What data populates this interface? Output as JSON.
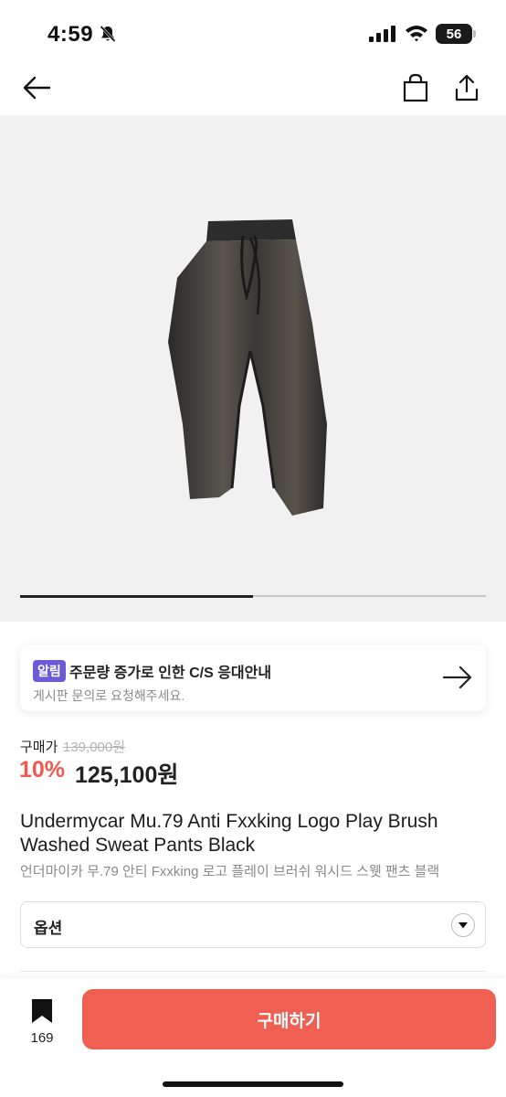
{
  "status_bar": {
    "time": "4:59",
    "battery": "56",
    "icons": [
      "bell-muted-icon",
      "signal-icon",
      "wifi-icon",
      "battery-icon"
    ]
  },
  "nav": {
    "icons": [
      "back-arrow-icon",
      "shopping-bag-icon",
      "share-icon"
    ]
  },
  "gallery": {
    "progress": 0.5
  },
  "notice": {
    "tag": "알림",
    "title": "주문량 증가로 인한 C/S 응대안내",
    "subtitle": "게시판 문의로 요청해주세요.",
    "tag_color": "#6b5bd6"
  },
  "price": {
    "label": "구매가",
    "original": "139,000원",
    "discount": "10%",
    "current": "125,100원",
    "accent_color": "#ef5a4f"
  },
  "product": {
    "title": "Undermycar Mu.79 Anti Fxxking Logo Play Brush Washed Sweat Pants Black",
    "subtitle": "언더마이카 무.79 안티 Fxxking 로고 플레이 브러쉬 워시드 스웻 팬츠 블랙"
  },
  "option": {
    "label": "옵션"
  },
  "bottom_bar": {
    "wish_count": "169",
    "buy_label": "구매하기",
    "buy_color": "#ef5f52"
  }
}
